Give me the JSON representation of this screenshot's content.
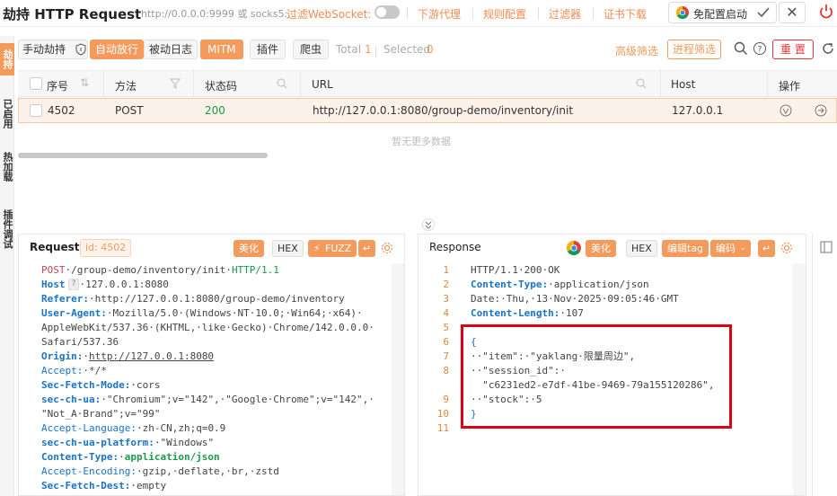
{
  "header": {
    "title": "劫持 HTTP Request",
    "proxy": "http://0.0.0.0:9999 或 socks5:...",
    "ws_label": "过滤WebSocket:",
    "links": [
      "下游代理",
      "规则配置",
      "过滤器",
      "证书下载"
    ],
    "chrome_btn": "免配置启动",
    "close": "✕"
  },
  "left_tabs": [
    "劫持",
    "已启用",
    "热加载",
    "插件调试"
  ],
  "toolbar": {
    "manual": "手动劫持",
    "auto": "自动放行",
    "passive": "被动日志",
    "mitm": "MITM",
    "plugin": "插件",
    "crawler": "爬虫",
    "total_label": "Total",
    "total": "1",
    "selected_label": "Selected",
    "selected": "0",
    "adv_filter": "高级筛选",
    "proc_filter": "进程筛选",
    "reset": "重 置"
  },
  "table": {
    "headers": {
      "seq": "序号",
      "method": "方法",
      "status": "状态码",
      "url": "URL",
      "host": "Host",
      "action": "操作"
    },
    "row": {
      "seq": "4502",
      "method": "POST",
      "status": "200",
      "url": "http://127.0.0.1:8080/group-demo/inventory/init",
      "host": "127.0.0.1"
    },
    "empty": "暂无更多数据"
  },
  "request": {
    "title": "Request",
    "id_label": "id: 4502",
    "beautify": "美化",
    "hex": "HEX",
    "fuzz": "FUZZ",
    "line1": {
      "method": "POST",
      "path": "·/group-demo/inventory/init·",
      "proto": "HTTP/1.1"
    },
    "headers": [
      {
        "k": "Host",
        "v": "·127.0.0.1:8080"
      },
      {
        "k": "Referer:",
        "v": "·http://127.0.0.1:8080/group-demo/inventory"
      },
      {
        "k": "User-Agent:",
        "v": "·Mozilla/5.0·(Windows·NT·10.0;·Win64;·x64)·"
      },
      {
        "k": "",
        "v": "AppleWebKit/537.36·(KHTML,·like·Gecko)·Chrome/142.0.0.0·"
      },
      {
        "k": "",
        "v": "Safari/537.36"
      },
      {
        "k": "Origin:",
        "v": "http://127.0.0.1:8080"
      },
      {
        "k": "Accept:",
        "v": "·*/*"
      },
      {
        "k": "Sec-Fetch-Mode:",
        "v": "·cors"
      },
      {
        "k": "sec-ch-ua:",
        "v": "·\"Chromium\";v=\"142\",·\"Google·Chrome\";v=\"142\",·"
      },
      {
        "k": "",
        "v": "\"Not_A·Brand\";v=\"99\""
      },
      {
        "k": "Accept-Language:",
        "v": "·zh-CN,zh;q=0.9"
      },
      {
        "k": "sec-ch-ua-platform:",
        "v": "·\"Windows\""
      },
      {
        "k": "Content-Type:",
        "v": "·application/json"
      },
      {
        "k": "Accept-Encoding:",
        "v": "·gzip,·deflate,·br,·zstd"
      },
      {
        "k": "Sec-Fetch-Dest:",
        "v": "·empty"
      }
    ]
  },
  "response": {
    "title": "Response",
    "beautify": "美化",
    "hex": "HEX",
    "edit_tag": "编辑tag",
    "encode": "编码",
    "line_numbers": [
      "1",
      "2",
      "3",
      "4",
      "5",
      "6",
      "7",
      "8",
      "",
      "9",
      "10",
      "11"
    ],
    "lines": [
      {
        "k": "",
        "v": "HTTP/1.1·200·OK"
      },
      {
        "k": "Content-Type:",
        "v": "·application/json"
      },
      {
        "k": "",
        "v": "Date:·Thu,·13·Nov·2025·09:05:46·GMT"
      },
      {
        "k": "Content-Length:",
        "v": "·107"
      },
      {
        "k": "",
        "v": ""
      },
      {
        "k": "",
        "v": "{"
      },
      {
        "k": "",
        "v": "··\"item\":·\"yaklang·限量周边\","
      },
      {
        "k": "",
        "v": "··\"session_id\":·"
      },
      {
        "k": "",
        "v": "  \"c6231ed2-e7df-41be-9469-79a155120286\","
      },
      {
        "k": "",
        "v": "··\"stock\":·5"
      },
      {
        "k": "",
        "v": "}"
      },
      {
        "k": "",
        "v": ""
      }
    ]
  },
  "colors": {
    "accent": "#f39a5c",
    "highlight": "#e00016"
  }
}
